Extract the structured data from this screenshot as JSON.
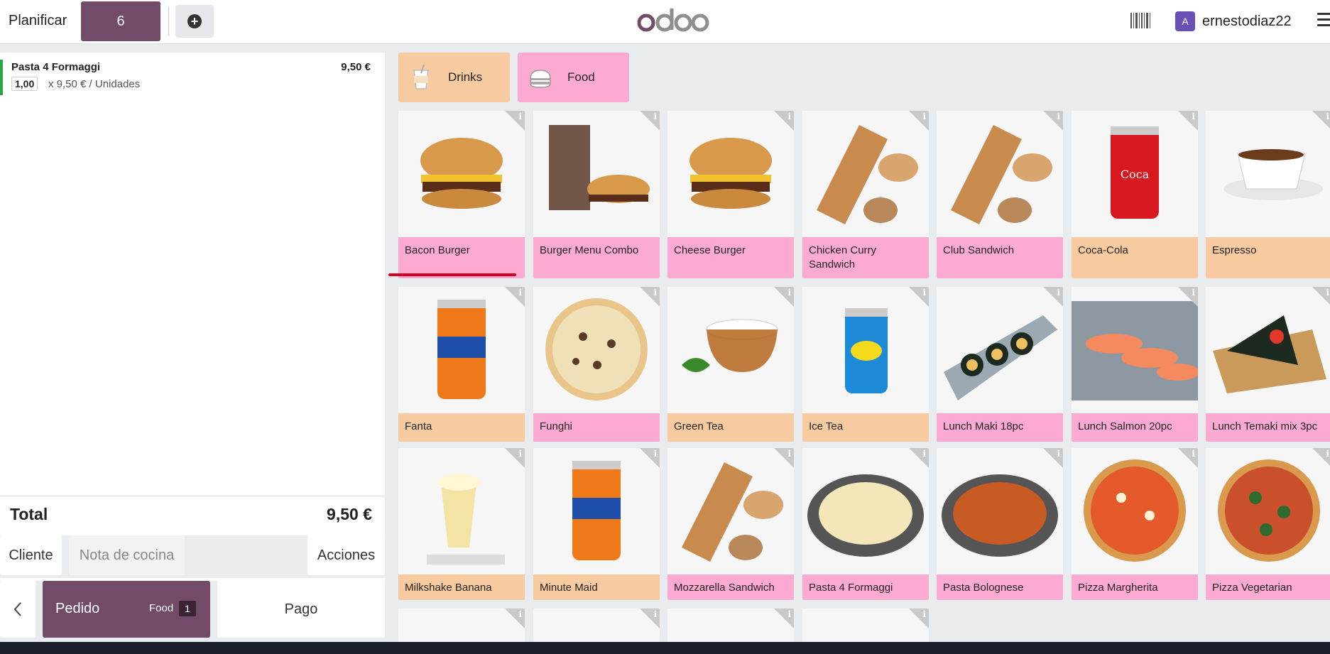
{
  "topbar": {
    "planificar": "Planificar",
    "table_number": "6",
    "username": "ernestodiaz22",
    "avatar_letter": "A"
  },
  "order": {
    "lines": [
      {
        "name": "Pasta 4 Formaggi",
        "price": "9,50 €",
        "qty": "1,00",
        "unit_text": "x 9,50 € / Unidades"
      }
    ],
    "total_label": "Total",
    "total_value": "9,50 €"
  },
  "actions": {
    "cliente": "Cliente",
    "nota": "Nota de cocina",
    "acciones": "Acciones"
  },
  "bottom": {
    "pedido": "Pedido",
    "pedido_tag": "Food",
    "pedido_count": "1",
    "pago": "Pago"
  },
  "categories": [
    {
      "label": "Drinks",
      "color": "#f8caa0"
    },
    {
      "label": "Food",
      "color": "#fdaad3"
    }
  ],
  "products": [
    {
      "name": "Bacon Burger",
      "cat": "food"
    },
    {
      "name": "Burger Menu Combo",
      "cat": "food"
    },
    {
      "name": "Cheese Burger",
      "cat": "food"
    },
    {
      "name": "Chicken Curry Sandwich",
      "cat": "food"
    },
    {
      "name": "Club Sandwich",
      "cat": "food"
    },
    {
      "name": "Coca-Cola",
      "cat": "drinks"
    },
    {
      "name": "Espresso",
      "cat": "drinks"
    },
    {
      "name": "Fanta",
      "cat": "drinks"
    },
    {
      "name": "Funghi",
      "cat": "food"
    },
    {
      "name": "Green Tea",
      "cat": "drinks"
    },
    {
      "name": "Ice Tea",
      "cat": "drinks"
    },
    {
      "name": "Lunch Maki 18pc",
      "cat": "food"
    },
    {
      "name": "Lunch Salmon 20pc",
      "cat": "food"
    },
    {
      "name": "Lunch Temaki mix 3pc",
      "cat": "food"
    },
    {
      "name": "Milkshake Banana",
      "cat": "drinks"
    },
    {
      "name": "Minute Maid",
      "cat": "drinks"
    },
    {
      "name": "Mozzarella Sandwich",
      "cat": "food"
    },
    {
      "name": "Pasta 4 Formaggi",
      "cat": "food"
    },
    {
      "name": "Pasta Bolognese",
      "cat": "food"
    },
    {
      "name": "Pizza Margherita",
      "cat": "food"
    },
    {
      "name": "Pizza Vegetarian",
      "cat": "food"
    }
  ],
  "colors": {
    "brand": "#714b67",
    "food": "#fdaad3",
    "drinks": "#f8caa0"
  }
}
